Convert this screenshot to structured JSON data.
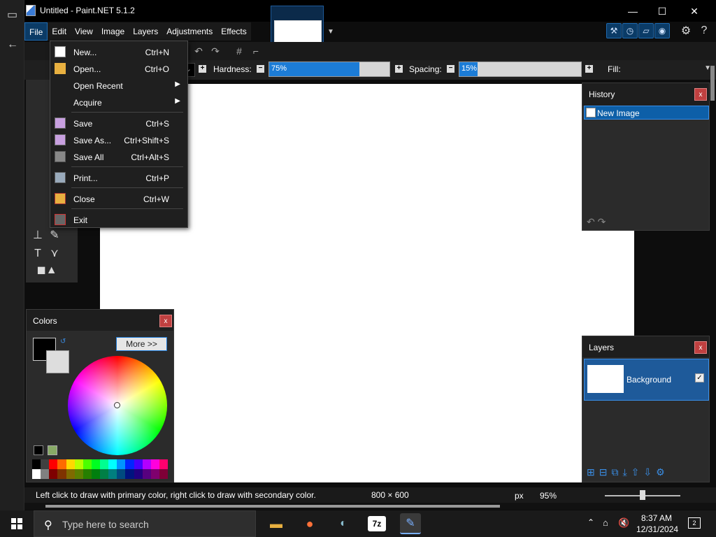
{
  "window": {
    "title": "Untitled - Paint.NET 5.1.2"
  },
  "menubar": {
    "items": [
      {
        "label": "File"
      },
      {
        "label": "Edit"
      },
      {
        "label": "View"
      },
      {
        "label": "Image"
      },
      {
        "label": "Layers"
      },
      {
        "label": "Adjustments"
      },
      {
        "label": "Effects"
      }
    ]
  },
  "toolbar": {
    "hardness_label": "Hardness:",
    "hardness_value": "75%",
    "hardness_fraction": 0.75,
    "spacing_label": "Spacing:",
    "spacing_value": "15%",
    "spacing_fraction": 0.15,
    "fill_label": "Fill:"
  },
  "file_menu": {
    "items": [
      {
        "label": "New...",
        "shortcut": "Ctrl+N",
        "icon": "new-image-icon"
      },
      {
        "label": "Open...",
        "shortcut": "Ctrl+O",
        "icon": "folder-open-icon"
      },
      {
        "label": "Open Recent",
        "shortcut": "",
        "submenu": true
      },
      {
        "label": "Acquire",
        "shortcut": "",
        "submenu": true
      },
      {
        "label": "Save",
        "shortcut": "Ctrl+S",
        "icon": "save-icon"
      },
      {
        "label": "Save As...",
        "shortcut": "Ctrl+Shift+S",
        "icon": "save-as-icon"
      },
      {
        "label": "Save All",
        "shortcut": "Ctrl+Alt+S",
        "icon": "save-all-icon"
      },
      {
        "label": "Print...",
        "shortcut": "Ctrl+P",
        "icon": "printer-icon"
      },
      {
        "label": "Close",
        "shortcut": "Ctrl+W",
        "icon": "close-file-icon"
      },
      {
        "label": "Exit",
        "shortcut": "",
        "icon": "exit-icon"
      }
    ]
  },
  "colors_panel": {
    "title": "Colors",
    "more_label": "More >>",
    "primary_color": "#000000",
    "secondary_color": "#dddddd",
    "palette": [
      "#000000",
      "#404040",
      "#ff0000",
      "#ff6a00",
      "#ffd800",
      "#b6ff00",
      "#4cff00",
      "#00ff21",
      "#00ff90",
      "#00ffff",
      "#0094ff",
      "#0026ff",
      "#4800ff",
      "#b200ff",
      "#ff00dc",
      "#ff006e",
      "#ffffff",
      "#808080",
      "#7f0000",
      "#7f3300",
      "#7f6a00",
      "#5b7f00",
      "#267f00",
      "#007f0e",
      "#007f46",
      "#007f7f",
      "#004a7f",
      "#00137f",
      "#21007f",
      "#57007f",
      "#7f006e",
      "#7f0037"
    ]
  },
  "history_panel": {
    "title": "History",
    "items": [
      {
        "label": "New Image"
      }
    ]
  },
  "layers_panel": {
    "title": "Layers",
    "layers": [
      {
        "name": "Background",
        "visible": true
      }
    ]
  },
  "statusbar": {
    "hint": "Left click to draw with primary color, right click to draw with secondary color.",
    "image_size": "800 × 600",
    "unit": "px",
    "zoom": "95%"
  },
  "taskbar": {
    "search_placeholder": "Type here to search",
    "time": "8:37 AM",
    "date": "12/31/2024",
    "notifications": "2",
    "app_7z_label": "7z"
  },
  "colors": {
    "accent": "#1c7cd6",
    "close_button": "#c04040"
  }
}
